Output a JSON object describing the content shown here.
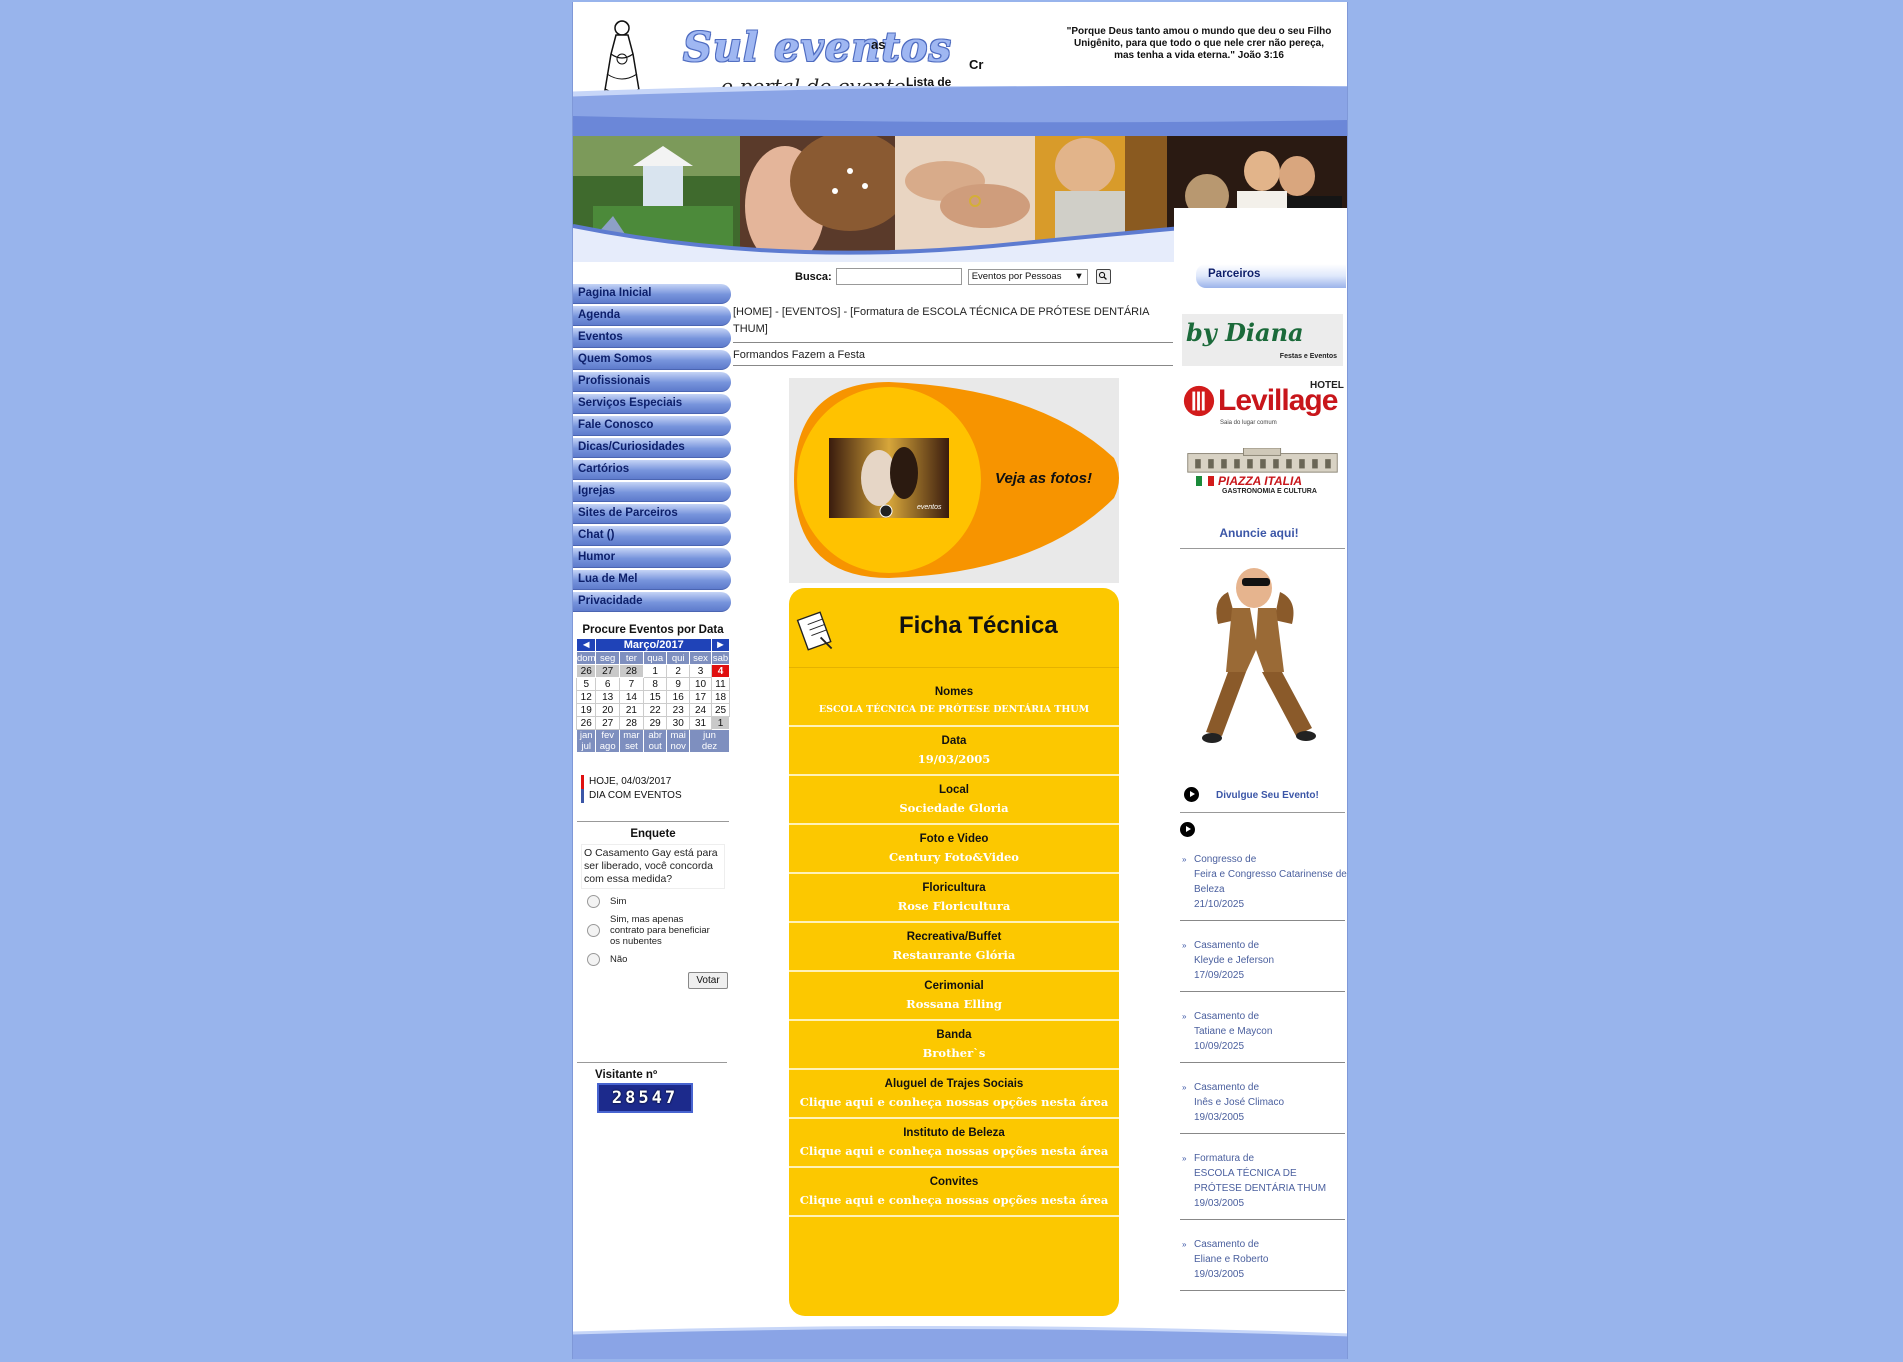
{
  "header": {
    "logo_text": "Sul eventos",
    "tagline": "o portal do evento",
    "frag_as": "as",
    "frag_cr": "Cr",
    "frag_lista": "Lista de",
    "verse": "\"Porque Deus tanto amou o mundo que deu o seu Filho Unigênito, para que todo o que nele crer não pereça, mas tenha a vida eterna.\" João 3:16"
  },
  "nav": {
    "items": [
      {
        "label": "Pagina Inicial"
      },
      {
        "label": "Agenda"
      },
      {
        "label": "Eventos"
      },
      {
        "label": "Quem Somos"
      },
      {
        "label": "Profissionais"
      },
      {
        "label": "Serviços Especiais"
      },
      {
        "label": "Fale Conosco"
      },
      {
        "label": "Dicas/Curiosidades"
      },
      {
        "label": "Cartórios"
      },
      {
        "label": "Igrejas"
      },
      {
        "label": "Sites de Parceiros"
      },
      {
        "label": "Chat  ()"
      },
      {
        "label": "Humor"
      },
      {
        "label": "Lua de Mel"
      },
      {
        "label": "Privacidade"
      }
    ]
  },
  "calendar": {
    "title": "Procure Eventos por Data",
    "month": "Março/2017",
    "weekdays": [
      "dom",
      "seg",
      "ter",
      "qua",
      "qui",
      "sex",
      "sab"
    ],
    "weeks": [
      [
        "26",
        "27",
        "28",
        "1",
        "2",
        "3",
        "4"
      ],
      [
        "5",
        "6",
        "7",
        "8",
        "9",
        "10",
        "11"
      ],
      [
        "12",
        "13",
        "14",
        "15",
        "16",
        "17",
        "18"
      ],
      [
        "19",
        "20",
        "21",
        "22",
        "23",
        "24",
        "25"
      ],
      [
        "26",
        "27",
        "28",
        "29",
        "30",
        "31",
        "1"
      ]
    ],
    "months_row1": [
      "jan",
      "fev",
      "mar",
      "abr",
      "mai",
      "jun"
    ],
    "months_row2": [
      "jul",
      "ago",
      "set",
      "out",
      "nov",
      "dez"
    ],
    "legend_today": "HOJE, 04/03/2017",
    "legend_events": "DIA COM EVENTOS",
    "today_color": "#e01010",
    "events_color": "#3b56a7"
  },
  "poll": {
    "title": "Enquete",
    "question": "O Casamento Gay está para ser liberado, você concorda com essa medida?",
    "options": [
      {
        "label": "Sim"
      },
      {
        "label": "Sim, mas apenas contrato para beneficiar os nubentes"
      },
      {
        "label": "Não"
      }
    ],
    "vote_label": "Votar"
  },
  "visitor": {
    "label": "Visitante nº",
    "count": "28547"
  },
  "search": {
    "label": "Busca:",
    "input_value": "",
    "select_value": "Eventos por Pessoas"
  },
  "breadcrumb": {
    "home": "[HOME]",
    "sep1": " - ",
    "events": "[EVENTOS]",
    "sep2": " - ",
    "current": "[Formatura de ESCOLA TÉCNICA DE PRÓTESE DENTÁRIA THUM]"
  },
  "subtitle": "Formandos Fazem a Festa",
  "promo": {
    "text": "Veja as fotos!",
    "photo_caption": "eventos"
  },
  "ficha": {
    "title": "Ficha Técnica",
    "fields": [
      {
        "label": "Nomes",
        "value": "ESCOLA TÉCNICA DE PRÓTESE DENTÁRIA THUM",
        "small": true
      },
      {
        "label": "Data",
        "value": "19/03/2005"
      },
      {
        "label": "Local",
        "value": "Sociedade Gloria"
      },
      {
        "label": "Foto e Video",
        "value": "Century Foto&Video"
      },
      {
        "label": "Floricultura",
        "value": "Rose Floricultura"
      },
      {
        "label": "Recreativa/Buffet",
        "value": "Restaurante Glória"
      },
      {
        "label": "Cerimonial",
        "value": "Rossana Elling"
      },
      {
        "label": "Banda",
        "value": "Brother`s"
      },
      {
        "label": "Aluguel de Trajes Sociais",
        "value": "Clique aqui e conheça nossas opções nesta área"
      },
      {
        "label": "Instituto de Beleza",
        "value": "Clique aqui e conheça nossas opções nesta área"
      },
      {
        "label": "Convites",
        "value": "Clique aqui e conheça nossas opções nesta área"
      }
    ]
  },
  "partners": {
    "title": "Parceiros",
    "ad1_script": "by Diana",
    "ad1_sub": "Festas e Eventos",
    "ad2_name": "Levillage",
    "ad2_hotel": "HOTEL",
    "ad2_sub": "Saia do lugar comum",
    "ad3_name": "PIAZZA ITALIA",
    "ad3_sub": "GASTRONOMIA E CULTURA",
    "anuncie": "Anuncie aqui!",
    "divulgue": "Divulgue Seu Evento!"
  },
  "recent_events": [
    {
      "type": "Congresso de",
      "name": "Feira e Congresso Catarinense de Beleza",
      "date": "21/10/2025"
    },
    {
      "type": "Casamento de",
      "name": "Kleyde e Jeferson",
      "date": "17/09/2025"
    },
    {
      "type": "Casamento de",
      "name": "Tatiane e Maycon",
      "date": "10/09/2025"
    },
    {
      "type": "Casamento de",
      "name": "Inês e José Climaco",
      "date": "19/03/2005"
    },
    {
      "type": "Formatura de",
      "name": "ESCOLA TÉCNICA DE PRÓTESE DENTÁRIA THUM",
      "date": "19/03/2005"
    },
    {
      "type": "Casamento de",
      "name": "Eliane e Roberto",
      "date": "19/03/2005"
    }
  ],
  "colors": {
    "background": "#98b4ec",
    "nav": "#7794dc",
    "ficha": "#fcc800",
    "promo_orange": "#f79400"
  }
}
